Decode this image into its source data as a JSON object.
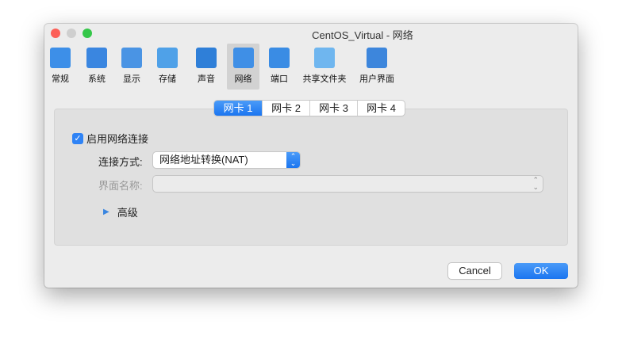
{
  "window": {
    "title": "CentOS_Virtual - 网络"
  },
  "toolbar": [
    {
      "label": "常规",
      "icon": "general-icon",
      "color": "#3d8fe8"
    },
    {
      "label": "系统",
      "icon": "system-chip-icon",
      "color": "#3a86e0"
    },
    {
      "label": "显示",
      "icon": "display-monitor-icon",
      "color": "#4a94e4"
    },
    {
      "label": "存储",
      "icon": "storage-disk-icon",
      "color": "#4fa1e8"
    },
    {
      "label": "声音",
      "icon": "speaker-icon",
      "color": "#2f7fd8"
    },
    {
      "label": "网络",
      "icon": "network-icon",
      "color": "#3f8fe6",
      "selected": true
    },
    {
      "label": "端口",
      "icon": "serial-port-icon",
      "color": "#3a8ce4"
    },
    {
      "label": "共享文件夹",
      "icon": "shared-folder-icon",
      "color": "#6fb6ef"
    },
    {
      "label": "用户界面",
      "icon": "user-interface-icon",
      "color": "#3d86dc"
    }
  ],
  "tabs": [
    "网卡 1",
    "网卡 2",
    "网卡 3",
    "网卡 4"
  ],
  "enable_label": "启用网络连接",
  "attached_label": "连接方式:",
  "attached_value": "网络地址转换(NAT)",
  "name_label": "界面名称:",
  "name_value": "",
  "advanced_label": "高级",
  "buttons": {
    "cancel": "Cancel",
    "ok": "OK"
  }
}
